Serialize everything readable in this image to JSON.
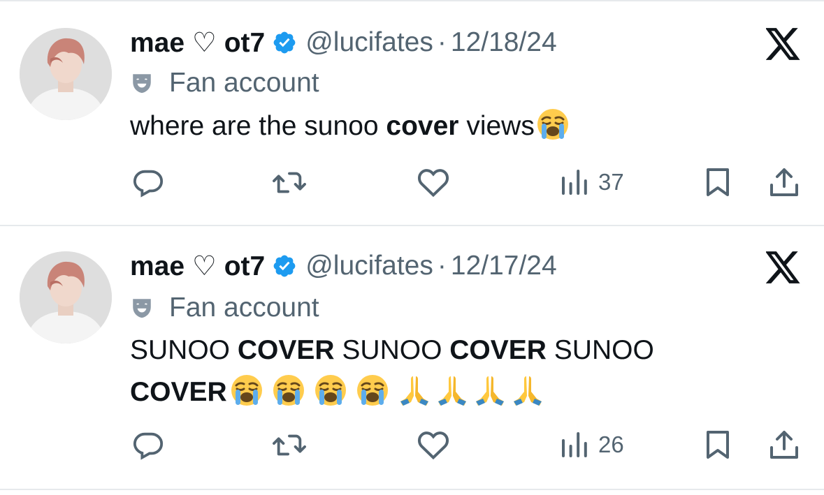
{
  "tweets": [
    {
      "display_name": "mae ♡ ot7",
      "handle": "@lucifates",
      "separator": "·",
      "date": "12/18/24",
      "account_label": "Fan account",
      "text_segments": [
        {
          "text": "where are the sunoo ",
          "bold": false
        },
        {
          "text": "cover",
          "bold": true
        },
        {
          "text": " views",
          "bold": false
        }
      ],
      "emojis": [
        "loudly-crying-face"
      ],
      "views": "37"
    },
    {
      "display_name": "mae ♡ ot7",
      "handle": "@lucifates",
      "separator": "·",
      "date": "12/17/24",
      "account_label": "Fan account",
      "text_segments": [
        {
          "text": "SUNOO ",
          "bold": false
        },
        {
          "text": "COVER",
          "bold": true
        },
        {
          "text": " SUNOO ",
          "bold": false
        },
        {
          "text": "COVER",
          "bold": true
        },
        {
          "text": " SUNOO ",
          "bold": false
        },
        {
          "text": "COVER",
          "bold": true
        }
      ],
      "emojis": [
        "loudly-crying-face",
        "loudly-crying-face",
        "loudly-crying-face",
        "loudly-crying-face",
        "folded-hands",
        "folded-hands",
        "folded-hands",
        "folded-hands"
      ],
      "views": "26"
    }
  ],
  "colors": {
    "text": "#0f1419",
    "secondary": "#536471",
    "verified": "#1d9bf0",
    "divider": "#e6e9ec"
  }
}
